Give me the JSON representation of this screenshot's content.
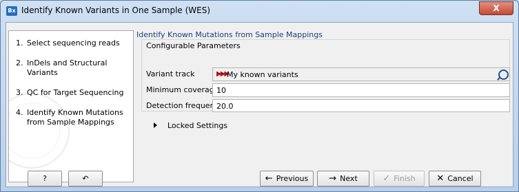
{
  "window": {
    "title": "Identify Known Variants in One Sample (WES)",
    "app_icon": "Bx",
    "close_label": "X"
  },
  "steps": [
    {
      "num": "1.",
      "label": "Select sequencing reads"
    },
    {
      "num": "2.",
      "label": "InDels and Structural Variants"
    },
    {
      "num": "3.",
      "label": "QC for Target Sequencing"
    },
    {
      "num": "4.",
      "label": "Identify Known Mutations from Sample Mappings"
    }
  ],
  "section": {
    "header": "Identify Known Mutations from Sample Mappings",
    "group_title": "Configurable Parameters",
    "params": {
      "variant_track_label": "Variant track",
      "variant_track_value": "My known variants",
      "min_coverage_label": "Minimum coverage",
      "min_coverage_value": "10",
      "detection_freq_label": "Detection frequency",
      "detection_freq_value": "20.0"
    },
    "locked_label": "Locked Settings"
  },
  "footer": {
    "help_label": "?",
    "reset_icon": "↶",
    "previous_label": "Previous",
    "next_label": "Next",
    "finish_label": "Finish",
    "cancel_label": "Cancel"
  }
}
